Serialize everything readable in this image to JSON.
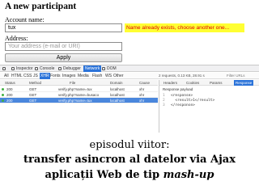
{
  "form": {
    "title": "A new participant",
    "account_label": "Account name:",
    "account_value": "tux",
    "account_error": "Name already exists, choose another one...",
    "address_label": "Address:",
    "address_placeholder": "Your address (e-mail or URI)",
    "apply_label": "Apply"
  },
  "devtools": {
    "tabs": [
      "Inspector",
      "Console",
      "Debugger",
      "Network",
      "DOM"
    ],
    "active_tab": "Network",
    "filters": [
      "All",
      "HTML",
      "CSS",
      "JS",
      "XHR",
      "Fonts",
      "Images",
      "Media",
      "Flash",
      "WS",
      "Other"
    ],
    "active_filter": "XHR",
    "summary": "2 requests, 0.13 KB, 28.91 s",
    "filter_placeholder": "Filter URLs",
    "columns": [
      "Status",
      "Method",
      "File",
      "Domain",
      "Cause",
      "Headers",
      "Cookies",
      "Params",
      "Response"
    ],
    "requests": [
      {
        "status": "200",
        "method": "GET",
        "file": "verify.php?name=tux",
        "domain": "localhost",
        "cause": "xhr"
      },
      {
        "status": "200",
        "method": "GET",
        "file": "verify.php?name=busaco",
        "domain": "localhost",
        "cause": "xhr"
      },
      {
        "status": "200",
        "method": "GET",
        "file": "verify.php?name=tux",
        "domain": "localhost",
        "cause": "xhr"
      }
    ],
    "detail_tabs": [
      "Headers",
      "Cookies",
      "Params",
      "Response"
    ],
    "active_detail_tab": "Response",
    "payload_title": "Response payload",
    "payload_lines": [
      {
        "n": "1",
        "code": "<response>"
      },
      {
        "n": "2",
        "code": "  <result>1</result>"
      },
      {
        "n": "3",
        "code": "</response>"
      }
    ],
    "status_color": "#43b043",
    "accent_color": "#2b73d9"
  },
  "caption": {
    "line1": "episodul viitor:",
    "line2": "transfer asincron al datelor via Ajax",
    "line3_prefix": "aplicații Web de tip ",
    "line3_emph": "mash-up"
  }
}
